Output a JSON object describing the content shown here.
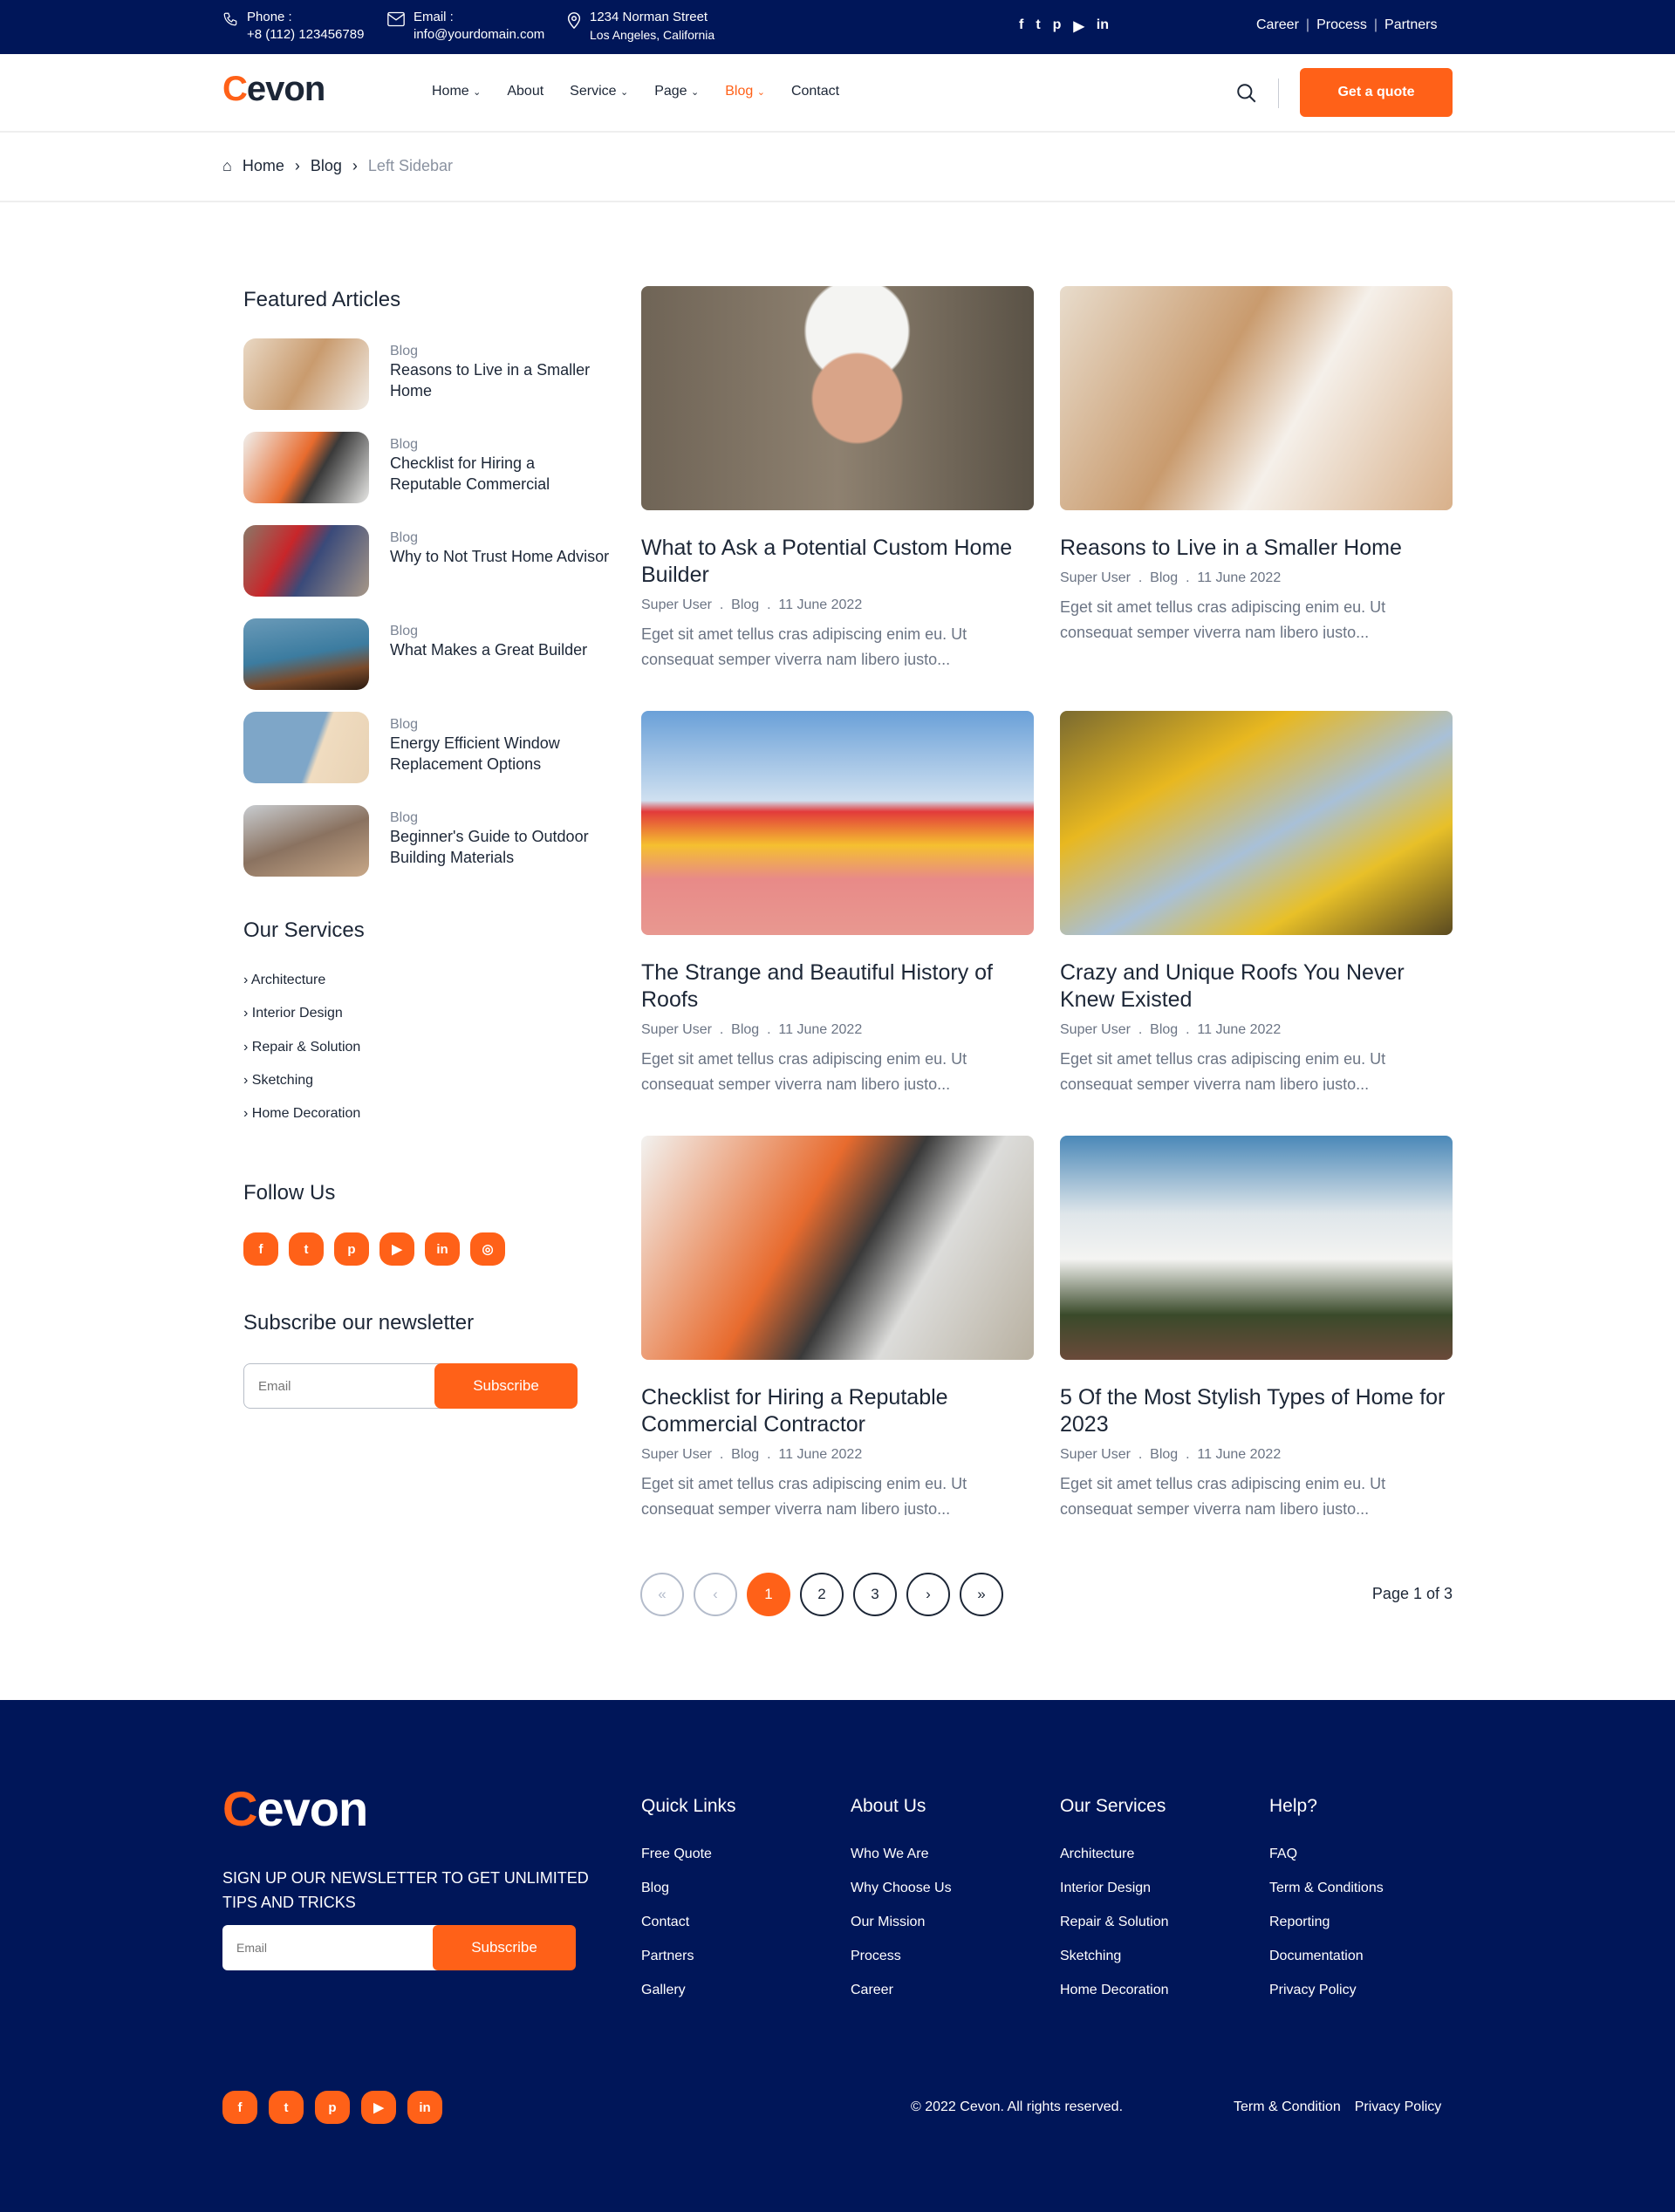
{
  "topbar": {
    "phone_label": "Phone :",
    "phone": "+8 (112) 123456789",
    "email_label": "Email :",
    "email": "info@yourdomain.com",
    "address1": "1234 Norman Street",
    "address2": "Los Angeles, California",
    "links": [
      "Career",
      "Process",
      "Partners"
    ],
    "social": [
      "facebook",
      "twitter",
      "pinterest",
      "youtube",
      "linkedin"
    ]
  },
  "brand": {
    "logo_c": "C",
    "logo_rest": "evon",
    "accent": "#ff6118",
    "navy": "#001659"
  },
  "nav": {
    "items": [
      "Home",
      "About",
      "Service",
      "Page",
      "Blog",
      "Contact"
    ],
    "active": "Blog",
    "quote": "Get a quote"
  },
  "breadcrumb": [
    "Home",
    "Blog",
    "Left Sidebar"
  ],
  "sidebar": {
    "featured_title": "Featured Articles",
    "featured": [
      {
        "cat": "Blog",
        "title": "Reasons to Live in a Smaller Home"
      },
      {
        "cat": "Blog",
        "title": "Checklist for Hiring a Reputable Commercial"
      },
      {
        "cat": "Blog",
        "title": "Why to Not Trust Home Advisor"
      },
      {
        "cat": "Blog",
        "title": "What Makes a Great Builder"
      },
      {
        "cat": "Blog",
        "title": "Energy Efficient Window Replacement Options"
      },
      {
        "cat": "Blog",
        "title": "Beginner's Guide to Outdoor Building Materials"
      }
    ],
    "services_title": "Our Services",
    "services": [
      "Architecture",
      "Interior Design",
      "Repair & Solution",
      "Sketching",
      "Home Decoration"
    ],
    "follow_title": "Follow Us",
    "follow": [
      "facebook",
      "twitter",
      "pinterest",
      "youtube",
      "linkedin",
      "instagram"
    ],
    "newsletter_title": "Subscribe our newsletter",
    "email_placeholder": "Email",
    "subscribe": "Subscribe"
  },
  "posts": [
    {
      "title": "What to Ask a Potential Custom Home Builder",
      "author": "Super User",
      "cat": "Blog",
      "date": "11 June 2022",
      "excerpt": "Eget sit amet tellus cras adipiscing enim eu. Ut consequat semper viverra nam libero justo..."
    },
    {
      "title": "Reasons to Live in a Smaller Home",
      "author": "Super User",
      "cat": "Blog",
      "date": "11 June 2022",
      "excerpt": "Eget sit amet tellus cras adipiscing enim eu. Ut consequat semper viverra nam libero justo..."
    },
    {
      "title": "The Strange and Beautiful History of Roofs",
      "author": "Super User",
      "cat": "Blog",
      "date": "11 June 2022",
      "excerpt": "Eget sit amet tellus cras adipiscing enim eu. Ut consequat semper viverra nam libero justo..."
    },
    {
      "title": "Crazy and Unique Roofs You Never Knew Existed",
      "author": "Super User",
      "cat": "Blog",
      "date": "11 June 2022",
      "excerpt": "Eget sit amet tellus cras adipiscing enim eu. Ut consequat semper viverra nam libero justo..."
    },
    {
      "title": "Checklist for Hiring a Reputable Commercial Contractor",
      "author": "Super User",
      "cat": "Blog",
      "date": "11 June 2022",
      "excerpt": "Eget sit amet tellus cras adipiscing enim eu. Ut consequat semper viverra nam libero justo..."
    },
    {
      "title": "5 Of the Most Stylish Types of Home for 2023",
      "author": "Super User",
      "cat": "Blog",
      "date": "11 June 2022",
      "excerpt": "Eget sit amet tellus cras adipiscing enim eu. Ut consequat semper viverra nam libero justo..."
    }
  ],
  "pagination": {
    "first": "«",
    "prev": "‹",
    "pages": [
      "1",
      "2",
      "3"
    ],
    "current": "1",
    "next": "›",
    "last": "»",
    "status": "Page 1 of 3"
  },
  "footer": {
    "newsletter_text": "SIGN UP OUR NEWSLETTER TO GET UNLIMITED TIPS AND TRICKS",
    "email_placeholder": "Email",
    "subscribe": "Subscribe",
    "columns": [
      {
        "title": "Quick Links",
        "links": [
          "Free Quote",
          "Blog",
          "Contact",
          "Partners",
          "Gallery"
        ]
      },
      {
        "title": "About Us",
        "links": [
          "Who We Are",
          "Why Choose Us",
          "Our Mission",
          "Process",
          "Career"
        ]
      },
      {
        "title": "Our Services",
        "links": [
          "Architecture",
          "Interior Design",
          "Repair & Solution",
          "Sketching",
          "Home Decoration"
        ]
      },
      {
        "title": "Help?",
        "links": [
          "FAQ",
          "Term & Conditions",
          "Reporting",
          "Documentation",
          "Privacy Policy"
        ]
      }
    ],
    "social": [
      "facebook",
      "twitter",
      "pinterest",
      "youtube",
      "linkedin"
    ],
    "copyright": "© 2022 Cevon. All rights reserved.",
    "bottom_links": [
      "Term & Condition",
      "Privacy Policy"
    ]
  }
}
